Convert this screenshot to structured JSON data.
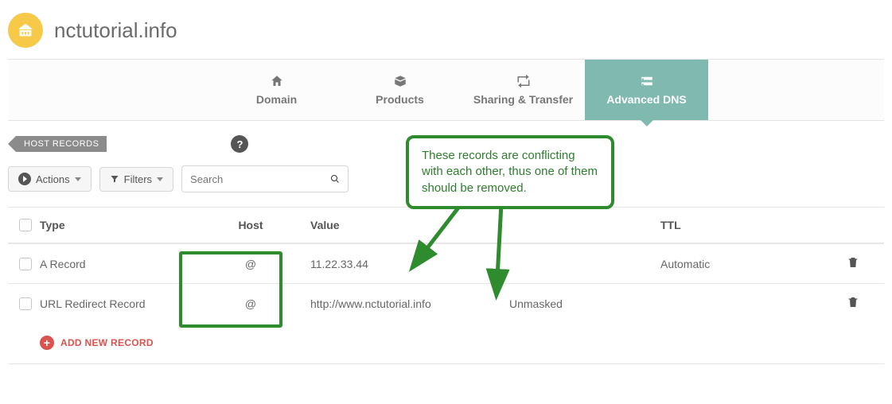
{
  "header": {
    "domain_name": "nctutorial.info"
  },
  "tabs": {
    "domain": "Domain",
    "products": "Products",
    "sharing": "Sharing & Transfer",
    "advanced_dns": "Advanced DNS"
  },
  "section": {
    "label": "HOST RECORDS"
  },
  "toolbar": {
    "actions_label": "Actions",
    "filters_label": "Filters",
    "search_placeholder": "Search"
  },
  "columns": {
    "type": "Type",
    "host": "Host",
    "value": "Value",
    "ttl": "TTL"
  },
  "records": [
    {
      "type": "A Record",
      "host": "@",
      "value": "11.22.33.44",
      "extra": "",
      "ttl": "Automatic"
    },
    {
      "type": "URL Redirect Record",
      "host": "@",
      "value": "http://www.nctutorial.info",
      "extra": "Unmasked",
      "ttl": ""
    }
  ],
  "add_record_label": "ADD NEW RECORD",
  "annotation": {
    "callout_text": "These records are conflicting with each other, thus one of them should be removed."
  }
}
